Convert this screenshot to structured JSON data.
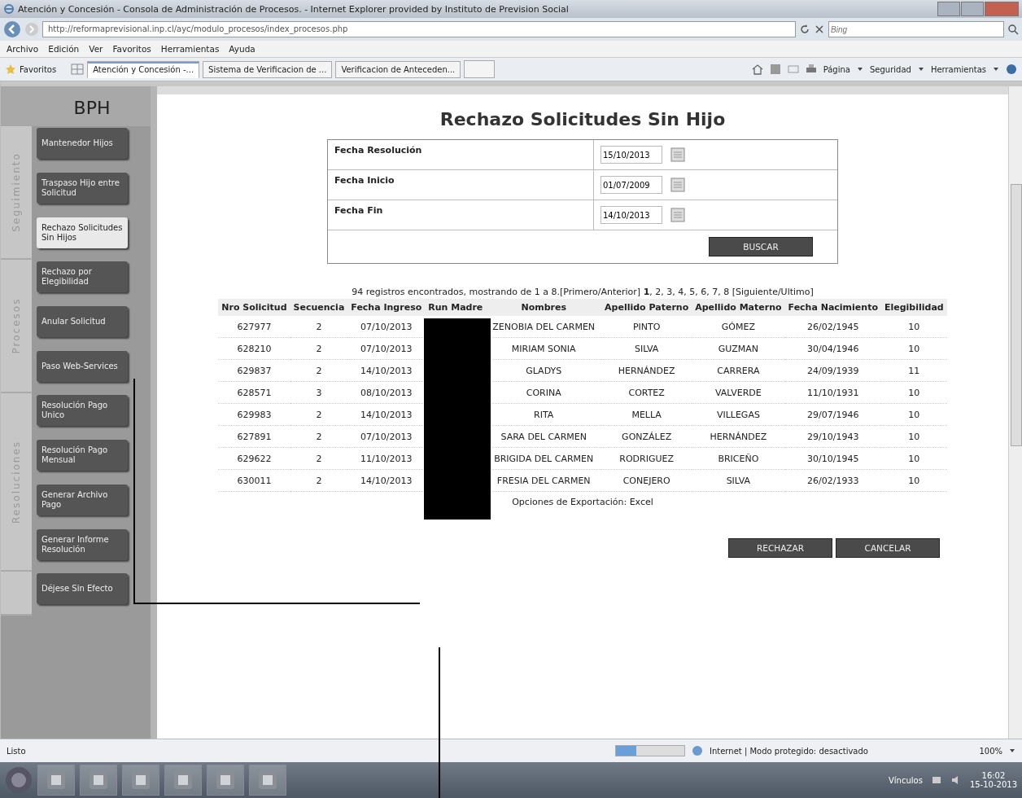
{
  "window": {
    "title": "Atención y Concesión - Consola de Administración de Procesos. - Internet Explorer provided by Instituto de Prevision Social"
  },
  "address_bar": {
    "url": "http://reformaprevisional.inp.cl/ayc/modulo_procesos/index_procesos.php",
    "search_placeholder": "Bing"
  },
  "menu": [
    "Archivo",
    "Edición",
    "Ver",
    "Favoritos",
    "Herramientas",
    "Ayuda"
  ],
  "favorites_bar": {
    "label": "Favoritos",
    "tabs": [
      {
        "label": "Atención y Concesión -...",
        "selected": true
      },
      {
        "label": "Sistema de Verificacion de ...",
        "selected": false
      },
      {
        "label": "Verificacion de Anteceden...",
        "selected": false
      }
    ],
    "commands": [
      "Página",
      "Seguridad",
      "Herramientas"
    ]
  },
  "sidebar": {
    "logo": "BPH",
    "sections": [
      {
        "label": "Seguimiento",
        "items": [
          {
            "label": "Mantenedor Hijos",
            "selected": false
          },
          {
            "label": "Traspaso Hijo entre Solicitud",
            "selected": false
          },
          {
            "label": "Rechazo Solicitudes Sin Hijos",
            "selected": true
          }
        ]
      },
      {
        "label": "Procesos",
        "items": [
          {
            "label": "Rechazo por Elegibilidad",
            "selected": false
          },
          {
            "label": "Anular Solicitud",
            "selected": false
          },
          {
            "label": "Paso Web-Services",
            "selected": false
          }
        ]
      },
      {
        "label": "Resoluciones",
        "items": [
          {
            "label": "Resolución Pago Unico",
            "selected": false
          },
          {
            "label": "Resolución Pago Mensual",
            "selected": false
          },
          {
            "label": "Generar Archivo Pago",
            "selected": false
          },
          {
            "label": "Generar Informe Resolución",
            "selected": false
          }
        ]
      },
      {
        "items": [
          {
            "label": "Déjese Sin Efecto",
            "selected": false
          }
        ]
      }
    ]
  },
  "page_title": "Rechazo Solicitudes Sin Hijo",
  "form": {
    "fields": [
      {
        "label": "Fecha Resolución",
        "value": "15/10/2013"
      },
      {
        "label": "Fecha Inicio",
        "value": "01/07/2009"
      },
      {
        "label": "Fecha Fin",
        "value": "14/10/2013"
      }
    ],
    "button": "BUSCAR"
  },
  "pagination": "94 registros encontrados, mostrando de 1 a 8.[Primero/Anterior] **1**, 2, 3, 4, 5, 6, 7, 8 [Siguiente/Ultimo]",
  "table": {
    "columns": [
      "Nro Solicitud",
      "Secuencia",
      "Fecha Ingreso",
      "Run Madre",
      "Nombres",
      "Apellido Paterno",
      "Apellido Materno",
      "Fecha Nacimiento",
      "Elegibilidad"
    ],
    "rows": [
      [
        "627977",
        "2",
        "07/10/2013",
        "",
        "ZENOBIA DEL CARMEN",
        "PINTO",
        "GÓMEZ",
        "26/02/1945",
        "10"
      ],
      [
        "628210",
        "2",
        "07/10/2013",
        "",
        "MIRIAM SONIA",
        "SILVA",
        "GUZMAN",
        "30/04/1946",
        "10"
      ],
      [
        "629837",
        "2",
        "14/10/2013",
        "",
        "GLADYS",
        "HERNÁNDEZ",
        "CARRERA",
        "24/09/1939",
        "11"
      ],
      [
        "628571",
        "3",
        "08/10/2013",
        "",
        "CORINA",
        "CORTEZ",
        "VALVERDE",
        "11/10/1931",
        "10"
      ],
      [
        "629983",
        "2",
        "14/10/2013",
        "",
        "RITA",
        "MELLA",
        "VILLEGAS",
        "29/07/1946",
        "10"
      ],
      [
        "627891",
        "2",
        "07/10/2013",
        "",
        "SARA DEL CARMEN",
        "GONZÁLEZ",
        "HERNÁNDEZ",
        "29/10/1943",
        "10"
      ],
      [
        "629622",
        "2",
        "11/10/2013",
        "",
        "BRIGIDA DEL CARMEN",
        "RODRIGUEZ",
        "BRICEÑO",
        "30/10/1945",
        "10"
      ],
      [
        "630011",
        "2",
        "14/10/2013",
        "",
        "FRESIA DEL CARMEN",
        "CONEJERO",
        "SILVA",
        "26/02/1933",
        "10"
      ]
    ]
  },
  "export": "Opciones de Exportación: Excel",
  "actions": [
    "RECHAZAR",
    "CANCELAR"
  ],
  "status_bar": {
    "text": "Listo",
    "progress": {
      "level": 0.3
    },
    "zone": "Internet | Modo protegido: desactivado",
    "zoom": "100%"
  },
  "taskbar": {
    "links": "Vínculos",
    "time": "16:02",
    "date": "15-10-2013"
  }
}
